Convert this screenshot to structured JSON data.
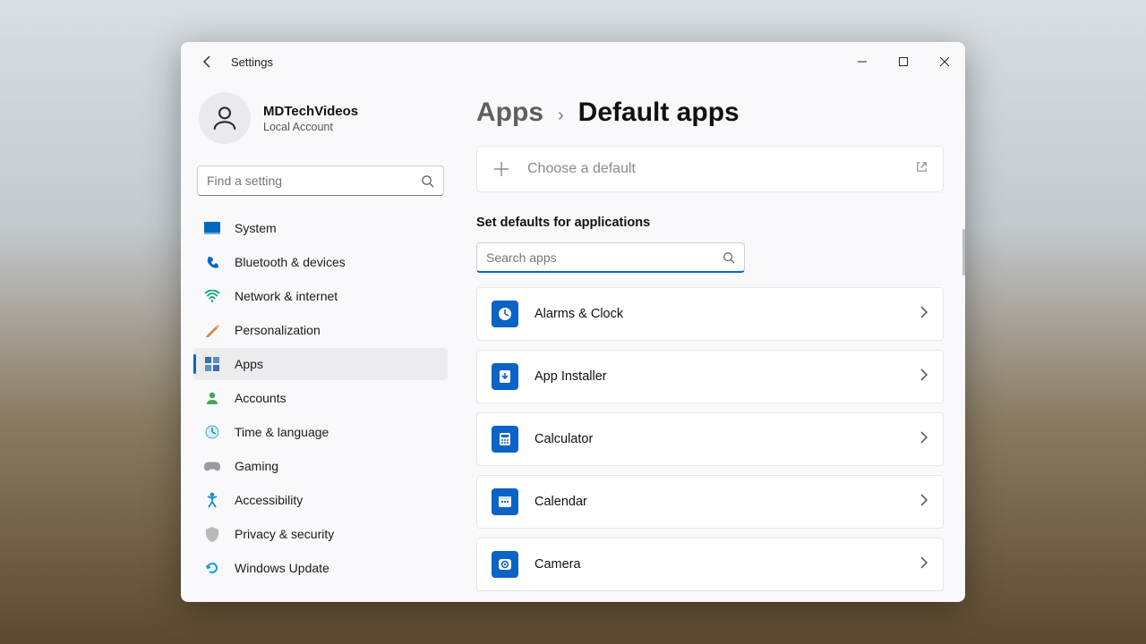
{
  "window": {
    "title": "Settings"
  },
  "user": {
    "name": "MDTechVideos",
    "sub": "Local Account"
  },
  "search": {
    "placeholder": "Find a setting"
  },
  "nav": {
    "items": [
      {
        "label": "System"
      },
      {
        "label": "Bluetooth & devices"
      },
      {
        "label": "Network & internet"
      },
      {
        "label": "Personalization"
      },
      {
        "label": "Apps"
      },
      {
        "label": "Accounts"
      },
      {
        "label": "Time & language"
      },
      {
        "label": "Gaming"
      },
      {
        "label": "Accessibility"
      },
      {
        "label": "Privacy & security"
      },
      {
        "label": "Windows Update"
      }
    ],
    "active_index": 4
  },
  "crumbs": {
    "parent": "Apps",
    "current": "Default apps"
  },
  "choose": {
    "label": "Choose a default"
  },
  "section": {
    "heading": "Set defaults for applications",
    "search_placeholder": "Search apps"
  },
  "apps": [
    {
      "label": "Alarms & Clock"
    },
    {
      "label": "App Installer"
    },
    {
      "label": "Calculator"
    },
    {
      "label": "Calendar"
    },
    {
      "label": "Camera"
    }
  ]
}
